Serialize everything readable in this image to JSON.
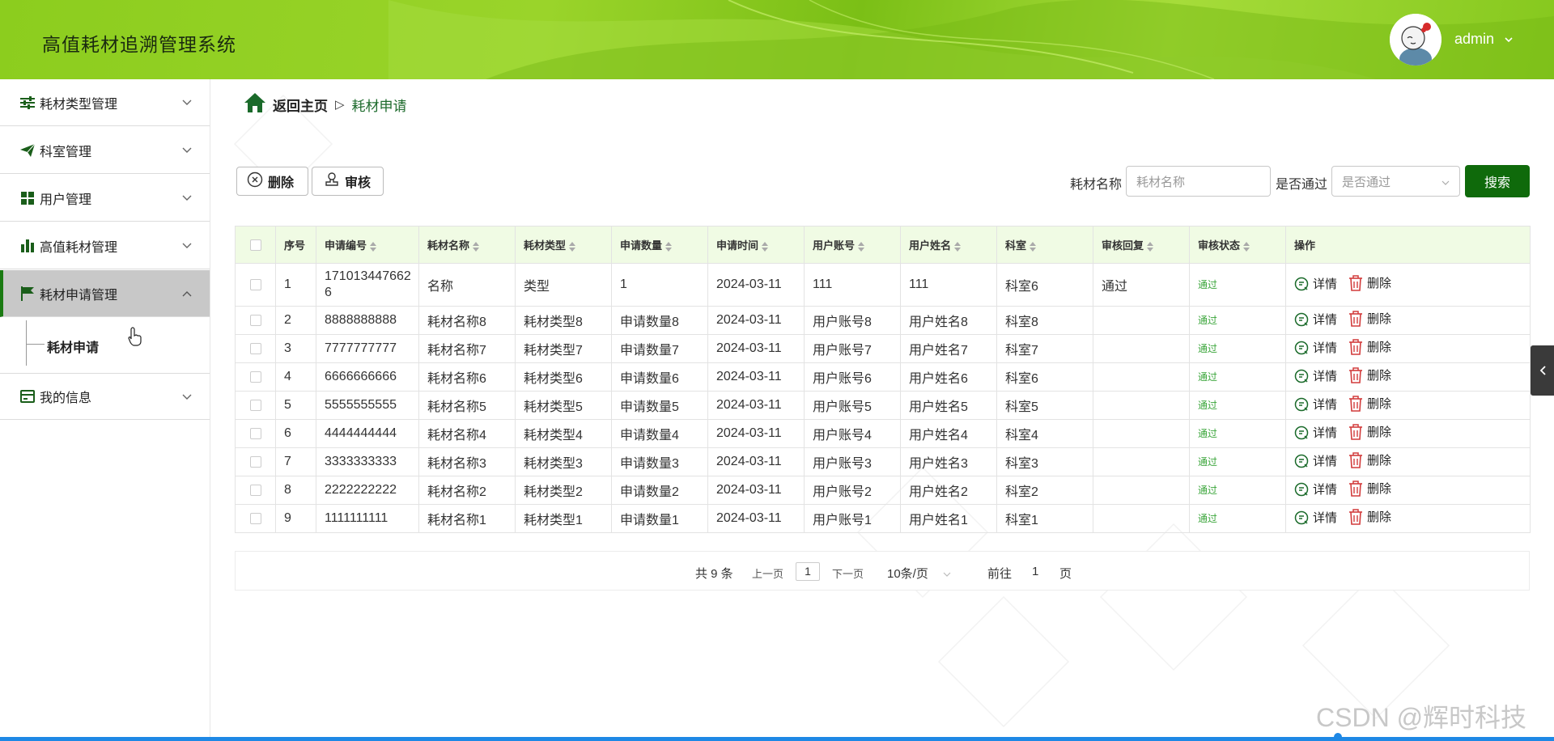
{
  "app": {
    "title": "高值耗材追溯管理系统",
    "user": "admin"
  },
  "sidebar": {
    "items": [
      {
        "label": "耗材类型管理",
        "icon": "sliders-icon"
      },
      {
        "label": "科室管理",
        "icon": "paper-plane-icon"
      },
      {
        "label": "用户管理",
        "icon": "grid-icon"
      },
      {
        "label": "高值耗材管理",
        "icon": "bar-chart-icon"
      },
      {
        "label": "耗材申请管理",
        "icon": "flag-icon"
      },
      {
        "label": "我的信息",
        "icon": "id-card-icon"
      }
    ],
    "subitem": "耗材申请"
  },
  "breadcrumb": {
    "home": "返回主页",
    "current": "耗材申请"
  },
  "toolbar": {
    "delete_label": "删除",
    "audit_label": "审核"
  },
  "filters": {
    "name_label": "耗材名称",
    "name_placeholder": "耗材名称",
    "pass_label": "是否通过",
    "pass_placeholder": "是否通过",
    "search_label": "搜索"
  },
  "table": {
    "headers": [
      "序号",
      "申请编号",
      "耗材名称",
      "耗材类型",
      "申请数量",
      "申请时间",
      "用户账号",
      "用户姓名",
      "科室",
      "审核回复",
      "审核状态",
      "操作"
    ],
    "detail_label": "详情",
    "delete_label": "删除",
    "rows": [
      [
        "1",
        "1710134476626",
        "名称",
        "类型",
        "1",
        "2024-03-11",
        "111",
        "111",
        "科室6",
        "通过",
        "通过"
      ],
      [
        "2",
        "8888888888",
        "耗材名称8",
        "耗材类型8",
        "申请数量8",
        "2024-03-11",
        "用户账号8",
        "用户姓名8",
        "科室8",
        "",
        "通过"
      ],
      [
        "3",
        "7777777777",
        "耗材名称7",
        "耗材类型7",
        "申请数量7",
        "2024-03-11",
        "用户账号7",
        "用户姓名7",
        "科室7",
        "",
        "通过"
      ],
      [
        "4",
        "6666666666",
        "耗材名称6",
        "耗材类型6",
        "申请数量6",
        "2024-03-11",
        "用户账号6",
        "用户姓名6",
        "科室6",
        "",
        "通过"
      ],
      [
        "5",
        "5555555555",
        "耗材名称5",
        "耗材类型5",
        "申请数量5",
        "2024-03-11",
        "用户账号5",
        "用户姓名5",
        "科室5",
        "",
        "通过"
      ],
      [
        "6",
        "4444444444",
        "耗材名称4",
        "耗材类型4",
        "申请数量4",
        "2024-03-11",
        "用户账号4",
        "用户姓名4",
        "科室4",
        "",
        "通过"
      ],
      [
        "7",
        "3333333333",
        "耗材名称3",
        "耗材类型3",
        "申请数量3",
        "2024-03-11",
        "用户账号3",
        "用户姓名3",
        "科室3",
        "",
        "通过"
      ],
      [
        "8",
        "2222222222",
        "耗材名称2",
        "耗材类型2",
        "申请数量2",
        "2024-03-11",
        "用户账号2",
        "用户姓名2",
        "科室2",
        "",
        "通过"
      ],
      [
        "9",
        "1111111111",
        "耗材名称1",
        "耗材类型1",
        "申请数量1",
        "2024-03-11",
        "用户账号1",
        "用户姓名1",
        "科室1",
        "",
        "通过"
      ]
    ]
  },
  "pagination": {
    "total": "共 9 条",
    "prev": "上一页",
    "page": "1",
    "next": "下一页",
    "page_size": "10条/页",
    "goto": "前往",
    "goto_value": "1",
    "page_unit": "页"
  },
  "watermark": "CSDN @辉时科技",
  "colors": {
    "primary": "#0f6a0b",
    "header": "#8ccd1e",
    "status_pass": "#3aa53a"
  }
}
